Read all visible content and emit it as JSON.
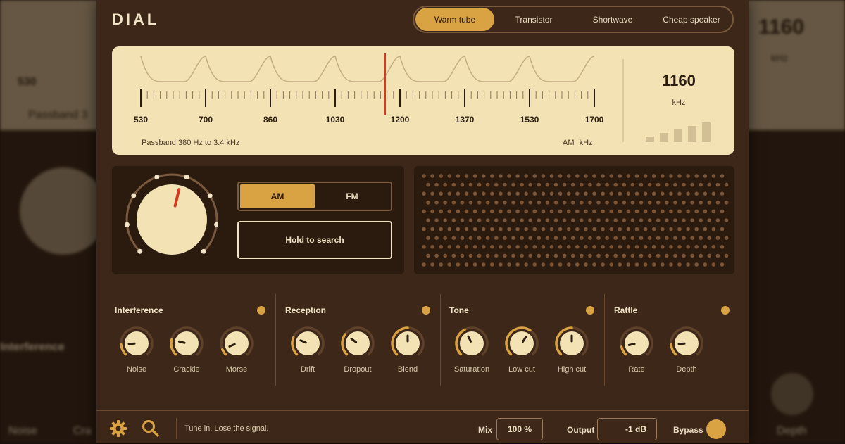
{
  "app": {
    "logo": "DIAL"
  },
  "presets": [
    {
      "label": "Warm tube",
      "active": true
    },
    {
      "label": "Transistor",
      "active": false
    },
    {
      "label": "Shortwave",
      "active": false
    },
    {
      "label": "Cheap speaker",
      "active": false
    }
  ],
  "dial": {
    "ticks": [
      "530",
      "700",
      "860",
      "1030",
      "1200",
      "1370",
      "1530",
      "1700"
    ],
    "tuned_value": 1160,
    "passband": "Passband 380 Hz to 3.4 kHz",
    "band": "AM",
    "band_unit": "kHz",
    "readout_value": "1160",
    "readout_unit": "kHz",
    "signal_bars": 5
  },
  "tuning": {
    "knob_position": 0.55,
    "modes": [
      {
        "label": "AM",
        "active": true
      },
      {
        "label": "FM",
        "active": false
      }
    ],
    "search_button": "Hold to search"
  },
  "sections": [
    {
      "title": "Interference",
      "knobs": [
        {
          "label": "Noise",
          "value": 0.15
        },
        {
          "label": "Crackle",
          "value": 0.22
        },
        {
          "label": "Morse",
          "value": 0.08
        }
      ]
    },
    {
      "title": "Reception",
      "knobs": [
        {
          "label": "Drift",
          "value": 0.25
        },
        {
          "label": "Dropout",
          "value": 0.3
        },
        {
          "label": "Blend",
          "value": 0.5
        }
      ]
    },
    {
      "title": "Tone",
      "knobs": [
        {
          "label": "Saturation",
          "value": 0.4
        },
        {
          "label": "Low cut",
          "value": 0.62
        },
        {
          "label": "High cut",
          "value": 0.5
        }
      ]
    },
    {
      "title": "Rattle",
      "knobs": [
        {
          "label": "Rate",
          "value": 0.12
        },
        {
          "label": "Depth",
          "value": 0.15
        }
      ]
    }
  ],
  "footer": {
    "status": "Tune in. Lose the signal.",
    "mix_label": "Mix",
    "mix_value": "100 %",
    "output_label": "Output",
    "output_value": "-1 dB",
    "bypass_label": "Bypass"
  },
  "background": {
    "value": "1160",
    "unit": "kHz",
    "tick": "530",
    "passband": "Passband 3",
    "interference": "Interference",
    "noise": "Noise",
    "crackle": "Cra",
    "depth": "Depth"
  },
  "colors": {
    "accent": "#d9a343",
    "panel": "#3d2718",
    "display": "#f2e2b4",
    "needle": "#d63a1c",
    "cream": "#f1e4c6"
  }
}
